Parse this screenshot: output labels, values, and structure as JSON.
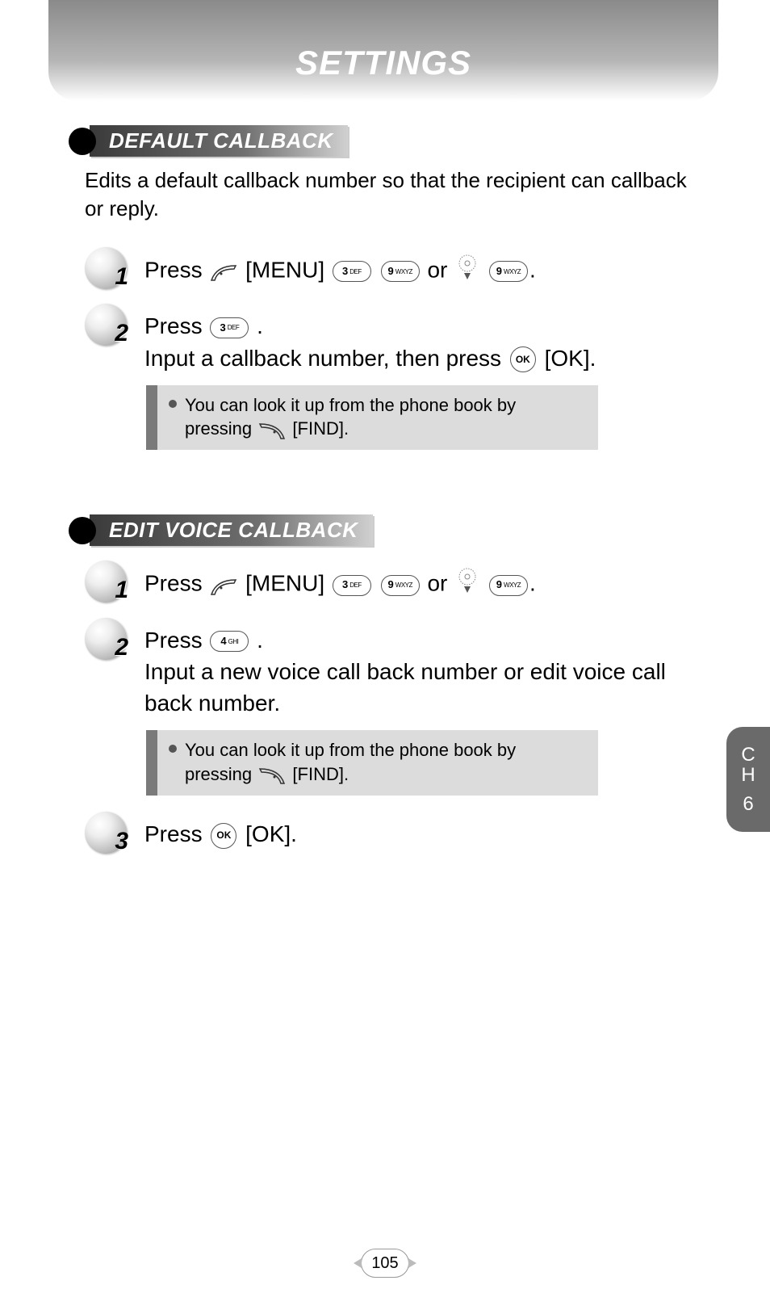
{
  "page_title": "SETTINGS",
  "sections": [
    {
      "heading": "DEFAULT CALLBACK",
      "intro": "Edits a default callback number so that the recipient can callback or reply.",
      "steps": [
        {
          "num": "1",
          "press": "Press",
          "menu": "[MENU]",
          "or": "or",
          "end": "."
        },
        {
          "num": "2",
          "press_a": "Press",
          "press_dot": ".",
          "body": "Input a callback number, then press",
          "ok_label": "[OK]."
        }
      ],
      "note": {
        "line1": "You can look it up from the phone book by",
        "line2_a": "pressing",
        "line2_b": "[FIND]."
      }
    },
    {
      "heading": "EDIT VOICE CALLBACK",
      "steps": [
        {
          "num": "1",
          "press": "Press",
          "menu": "[MENU]",
          "or": "or",
          "end": "."
        },
        {
          "num": "2",
          "press_a": "Press",
          "press_dot": ".",
          "body": "Input a new voice call back number or edit voice call back number."
        },
        {
          "num": "3",
          "press_a": "Press",
          "ok_label": "[OK]."
        }
      ],
      "note": {
        "line1": "You can look it up from the phone book by",
        "line2_a": "pressing",
        "line2_b": "[FIND]."
      }
    }
  ],
  "keys": {
    "three": {
      "n": "3",
      "l": "DEF"
    },
    "nine": {
      "n": "9",
      "l": "WXYZ"
    },
    "four": {
      "n": "4",
      "l": "GHI"
    },
    "ok": "OK"
  },
  "side_tab": {
    "line1": "C",
    "line2": "H",
    "num": "6"
  },
  "page_number": "105"
}
